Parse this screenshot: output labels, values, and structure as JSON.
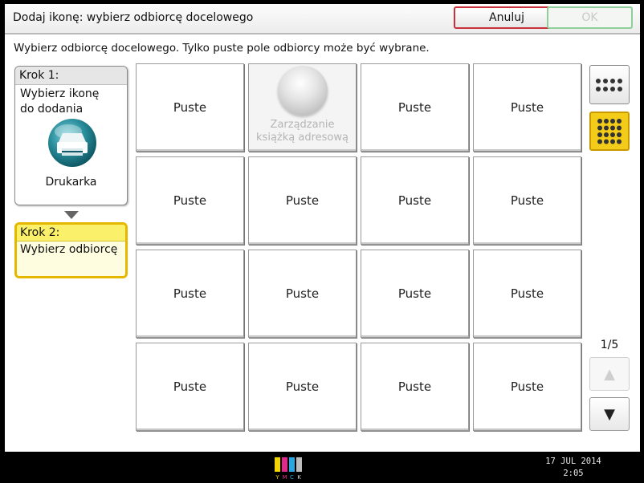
{
  "title": "Dodaj ikonę: wybierz odbiorcę docelowego",
  "buttons": {
    "cancel": "Anuluj",
    "ok": "OK"
  },
  "instruction": "Wybierz odbiorcę docelowego. Tylko puste pole odbiorcy może być wybrane.",
  "steps": {
    "step1": {
      "heading": "Krok 1:",
      "line1": "Wybierz ikonę",
      "line2": "do dodania",
      "selected": "Drukarka",
      "icon": "printer-icon"
    },
    "step2": {
      "heading": "Krok 2:",
      "body": "Wybierz odbiorcę"
    }
  },
  "grid": {
    "cells": [
      "Puste",
      "Zarządzanie książką adresową",
      "Puste",
      "Puste",
      "Puste",
      "Puste",
      "Puste",
      "Puste",
      "Puste",
      "Puste",
      "Puste",
      "Puste",
      "Puste",
      "Puste",
      "Puste",
      "Puste"
    ],
    "disabled_label_line1": "Zarządzanie",
    "disabled_label_line2": "książką adresową"
  },
  "view_buttons": [
    "small-grid-icon",
    "large-grid-icon"
  ],
  "pager": {
    "text": "1/5"
  },
  "footer": {
    "toner_labels": [
      "Y",
      "M",
      "C",
      "K"
    ],
    "toner_colors": [
      "#f2d400",
      "#e0298a",
      "#2aa7e0",
      "#444444"
    ],
    "date": "17 JUL  2014",
    "time": "2:05"
  }
}
